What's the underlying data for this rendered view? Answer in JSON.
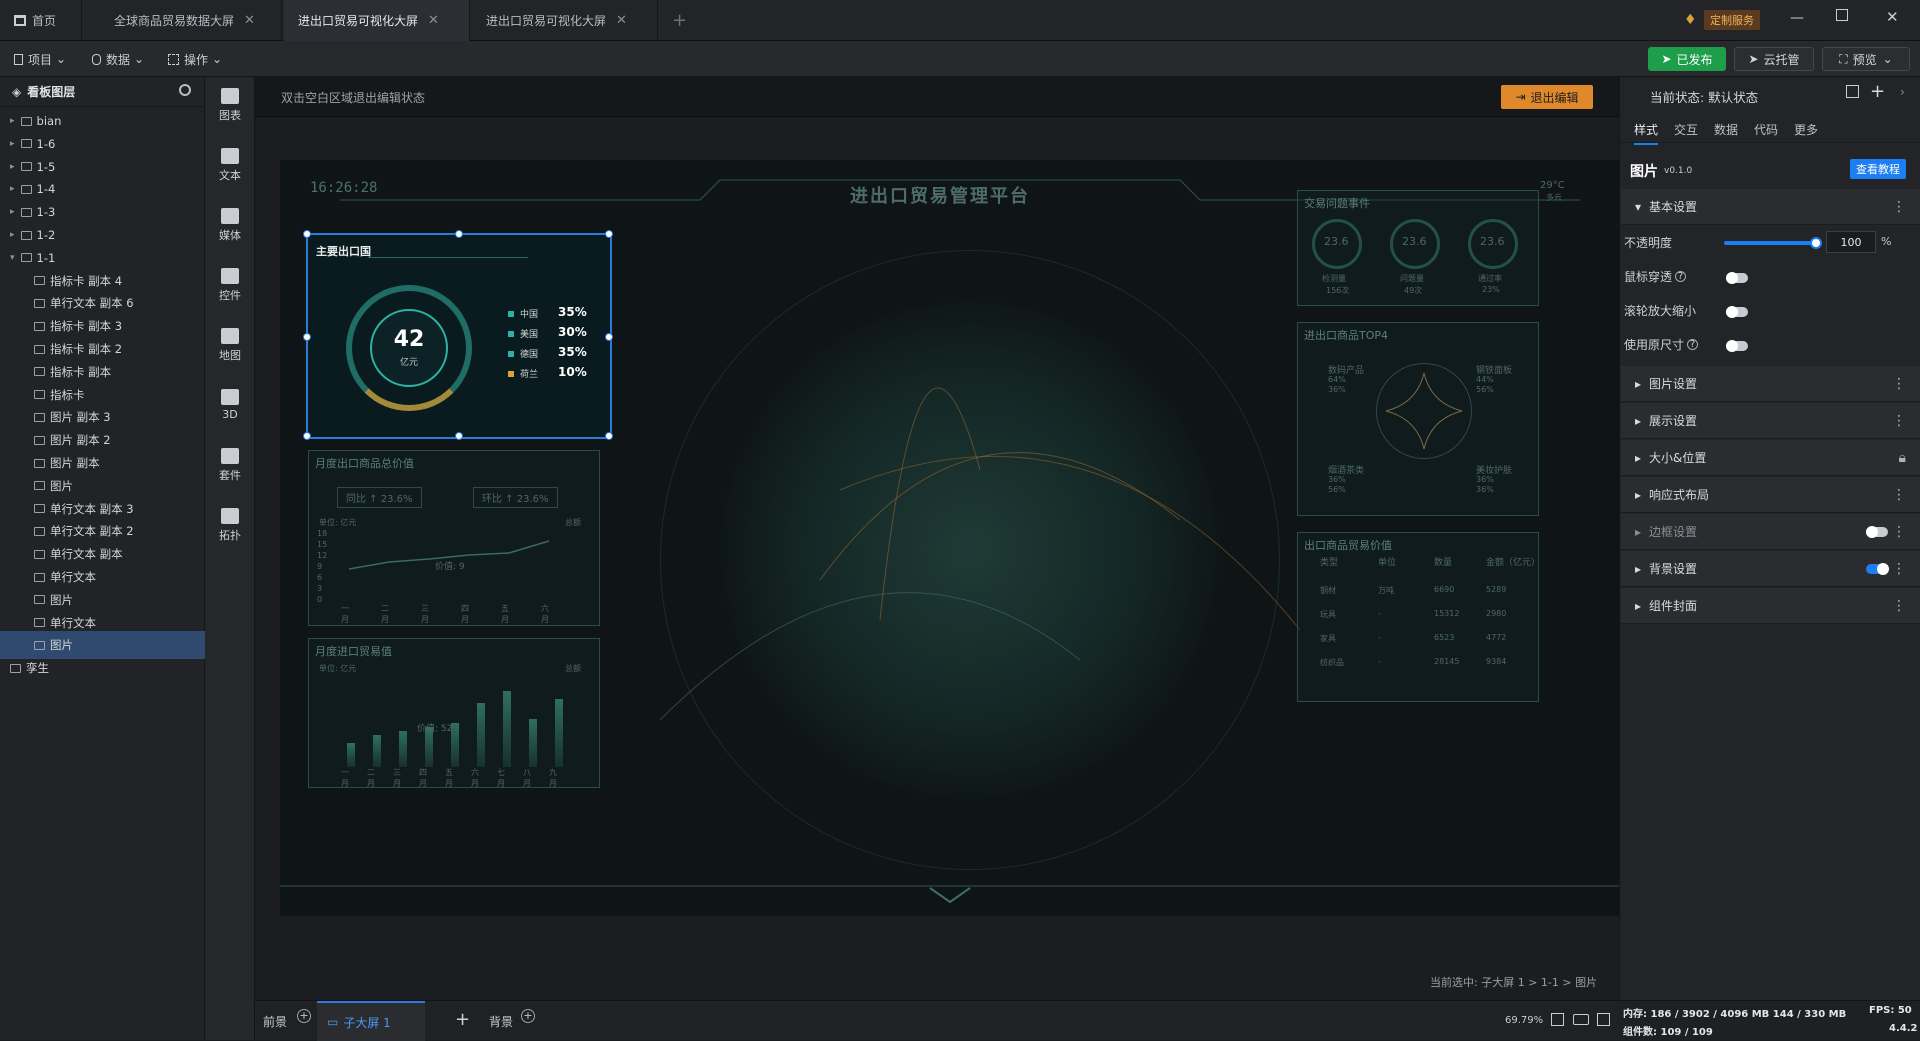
{
  "tabs": [
    {
      "label": "首页"
    },
    {
      "label": "全球商品贸易数据大屏"
    },
    {
      "label": "进出口贸易可视化大屏"
    },
    {
      "label": "进出口贸易可视化大屏"
    }
  ],
  "header_right": {
    "custom_service": "定制服务"
  },
  "toolbar": {
    "project": "项目",
    "data": "数据",
    "operate": "操作",
    "published": "已发布",
    "cloud": "云托管",
    "preview": "预览"
  },
  "layers_panel": {
    "title": "看板图层",
    "items": [
      "bian",
      "1-6",
      "1-5",
      "1-4",
      "1-3",
      "1-2",
      "1-1",
      "指标卡 副本 4",
      "单行文本 副本 6",
      "指标卡 副本 3",
      "指标卡 副本 2",
      "指标卡 副本",
      "指标卡",
      "图片 副本 3",
      "图片 副本 2",
      "图片 副本",
      "图片",
      "单行文本 副本 3",
      "单行文本 副本 2",
      "单行文本 副本",
      "单行文本",
      "图片",
      "单行文本",
      "图片",
      "孪生"
    ]
  },
  "components": [
    "图表",
    "文本",
    "媒体",
    "控件",
    "地图",
    "3D",
    "套件",
    "拓扑"
  ],
  "canvas": {
    "hint": "双击空白区域退出编辑状态",
    "exit_edit": "退出编辑",
    "selection_path": "当前选中: 子大屏 1 > 1-1 > 图片"
  },
  "screen": {
    "time": "16:26:28",
    "title": "进出口贸易管理平台",
    "weather_temp": "29°C",
    "weather_desc": "多云",
    "card_main": {
      "title": "主要出口国",
      "value": "42",
      "unit": "亿元",
      "items": [
        {
          "label": "中国",
          "value": "35%"
        },
        {
          "label": "美国",
          "value": "30%"
        },
        {
          "label": "德国",
          "value": "35%"
        },
        {
          "label": "荷兰",
          "value": "10%"
        }
      ],
      "colors": [
        "#2bb3a3",
        "#2bb3a3",
        "#2bb3a3",
        "#d7a43a"
      ]
    },
    "panel_monthly_export": {
      "title": "月度出口商品总价值",
      "stat1": "同比 ↑ 23.6%",
      "stat2": "环比 ↑ 23.6%",
      "unit": "单位: 亿元",
      "legend": "总额",
      "tooltip": "价值: 9",
      "months": [
        "一月",
        "二月",
        "三月",
        "四月",
        "五月",
        "六月"
      ],
      "yticks": [
        "18",
        "15",
        "12",
        "9",
        "6",
        "3",
        "0"
      ]
    },
    "panel_monthly_import": {
      "title": "月度进口贸易值",
      "unit": "单位: 亿元",
      "legend": "总额",
      "tooltip": "价值: 52",
      "months": [
        "一月",
        "二月",
        "三月",
        "四月",
        "五月",
        "六月",
        "七月",
        "八月",
        "九月"
      ],
      "yticks": [
        "70",
        "60",
        "50",
        "40",
        "30",
        "20",
        "10",
        "0"
      ]
    },
    "panel_events": {
      "title": "交易问题事件",
      "gauges": [
        {
          "value": "23.6",
          "label": "检测量",
          "sub": "156次"
        },
        {
          "value": "23.6",
          "label": "问题量",
          "sub": "49次"
        },
        {
          "value": "23.6",
          "label": "通过率",
          "sub": "23%"
        }
      ]
    },
    "panel_top4": {
      "title": "进出口商品TOP4",
      "items": [
        {
          "label": "数码产品",
          "a": "64%",
          "b": "36%"
        },
        {
          "label": "钢铁面板",
          "a": "44%",
          "b": "56%"
        },
        {
          "label": "烟酒茶类",
          "a": "36%",
          "b": "56%"
        },
        {
          "label": "美妆护肤",
          "a": "36%",
          "b": "36%"
        }
      ]
    },
    "panel_table": {
      "title": "出口商品贸易价值",
      "headers": [
        "类型",
        "单位",
        "数量",
        "金额（亿元）"
      ],
      "rows": [
        [
          "钢材",
          "万吨",
          "6690",
          "5289"
        ],
        [
          "玩具",
          "-",
          "15312",
          "2980"
        ],
        [
          "家具",
          "-",
          "6523",
          "4772"
        ],
        [
          "纺织品",
          "-",
          "28145",
          "9384"
        ]
      ]
    }
  },
  "bottom": {
    "front": "前景",
    "subscreen": "子大屏 1",
    "background": "背景",
    "zoom": "69.79%"
  },
  "right_panel": {
    "state_label": "当前状态: 默认状态",
    "tabs": [
      "样式",
      "交互",
      "数据",
      "代码",
      "更多"
    ],
    "component_name": "图片",
    "version": "v0.1.0",
    "tutorial": "查看教程",
    "sections": [
      "基本设置",
      "图片设置",
      "展示设置",
      "大小&位置",
      "响应式布局",
      "边框设置",
      "背景设置",
      "组件封面"
    ],
    "opacity_label": "不透明度",
    "opacity_value": "100",
    "opacity_unit": "%",
    "opacity_fraction": 1.0,
    "mouse_through": "鼠标穿透",
    "wheel_zoom": "滚轮放大缩小",
    "original_size": "使用原尺寸"
  },
  "status": {
    "memory": "内存: 186 / 3902 / 4096 MB 144 / 330 MB",
    "fps": "FPS: 50",
    "components": "组件数: 109 / 109",
    "version": "4.4.2"
  }
}
